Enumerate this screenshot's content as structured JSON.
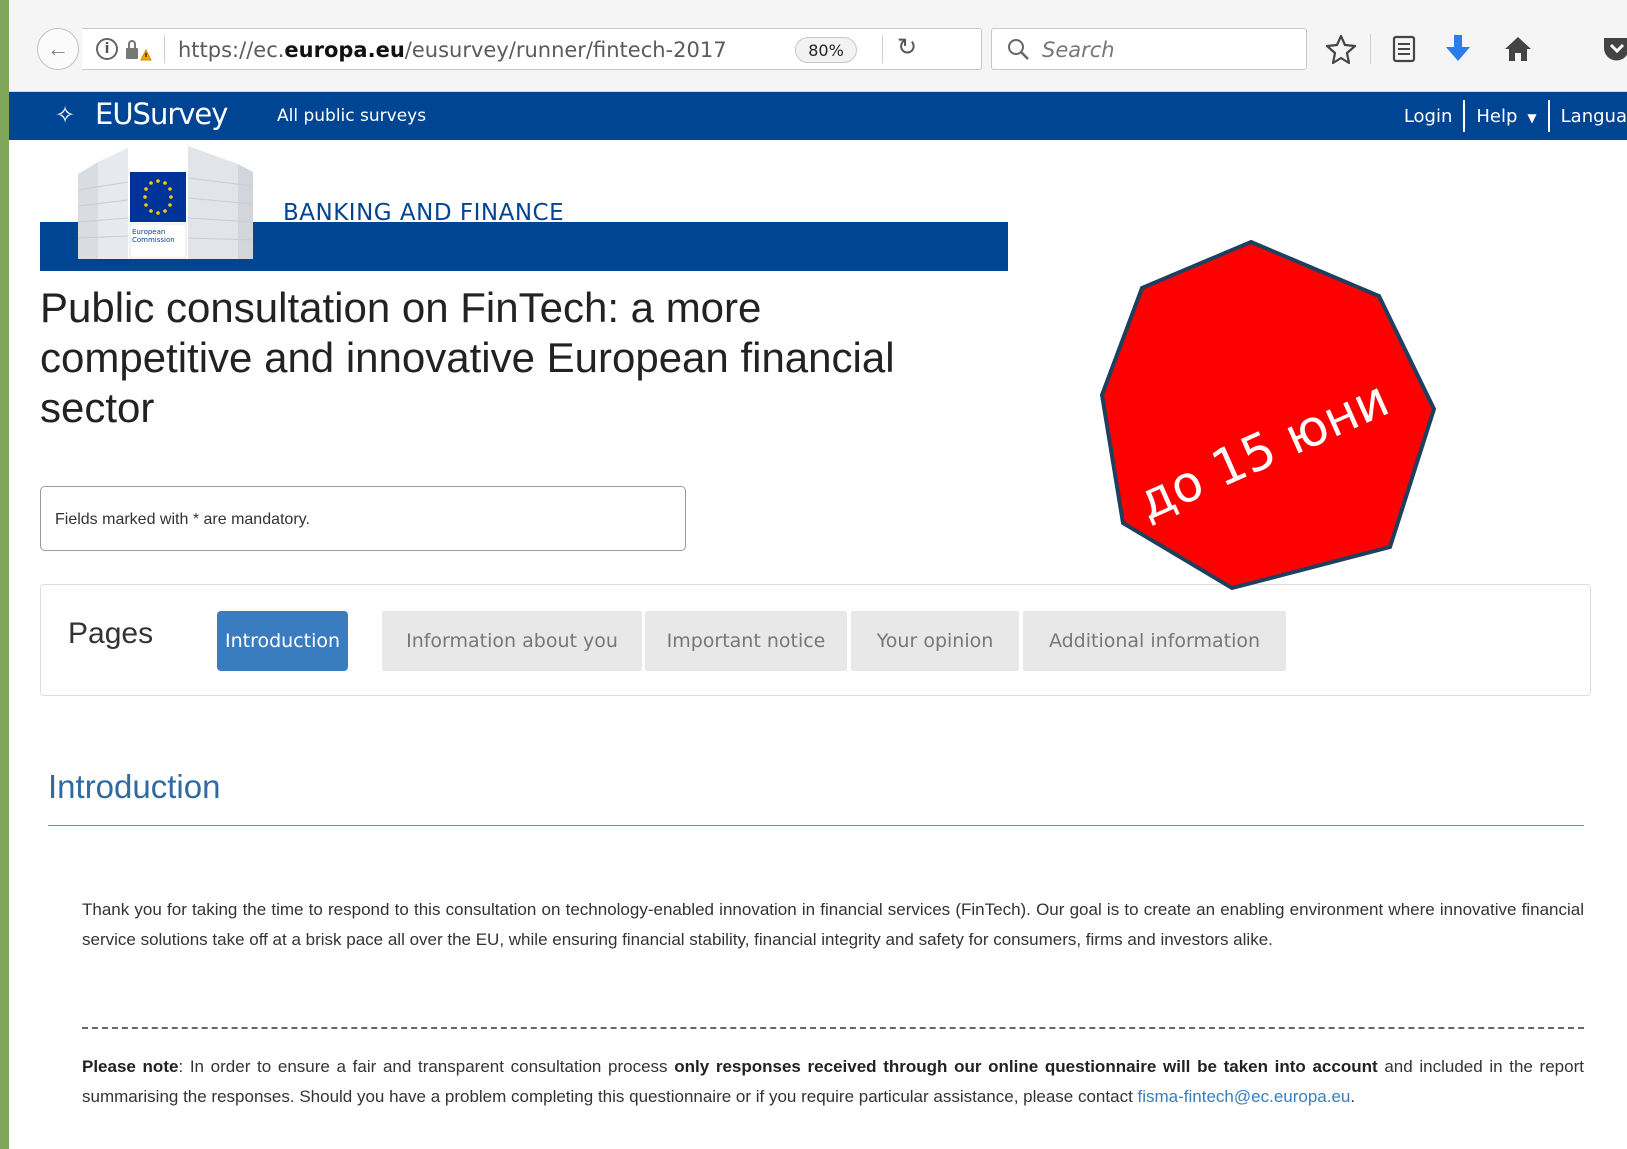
{
  "browser": {
    "url_prefix": "https://ec.",
    "url_domain": "europa.eu",
    "url_path": "/eusurvey/runner/fintech-2017",
    "zoom": "80%",
    "search_placeholder": "Search"
  },
  "eu_header": {
    "logo_text": "EUSurvey",
    "public_surveys": "All public surveys",
    "login": "Login",
    "help": "Help",
    "language": "Langua"
  },
  "banner": {
    "title": "BANKING AND FINANCE",
    "logo_caption_1": "European",
    "logo_caption_2": "Commission"
  },
  "survey": {
    "title": "Public consultation on FinTech: a more competitive and innovative European financial sector",
    "mandatory_note": "Fields marked with * are mandatory."
  },
  "pages": {
    "label": "Pages",
    "tabs": [
      {
        "label": "Introduction",
        "active": true
      },
      {
        "label": "Information about you",
        "active": false
      },
      {
        "label": "Important notice",
        "active": false
      },
      {
        "label": "Your opinion",
        "active": false
      },
      {
        "label": "Additional information",
        "active": false
      }
    ]
  },
  "introduction": {
    "heading": "Introduction",
    "paragraph1": "Thank you for taking the time to respond to this consultation on technology-enabled innovation in financial services (FinTech). Our goal is to create an enabling environment where innovative financial service solutions take off at a brisk pace all over the EU, while ensuring financial stability, financial integrity and safety for consumers, firms and investors alike.",
    "note_label": "Please note",
    "note_part1": ": In order to ensure a fair and transparent consultation process ",
    "note_bold": "only responses received through our online questionnaire will be taken into account",
    "note_part2": " and included in the report summarising the responses. Should you have a problem completing this questionnaire or if you require particular assistance, please contact ",
    "email": "fisma-fintech@ec.europa.eu",
    "note_end": "."
  },
  "stop_sign": {
    "text": "до 15 юни",
    "fill_color": "#ff0000",
    "border_color": "#1f3f5f"
  },
  "colors": {
    "eu_blue": "#004494",
    "active_tab": "#3a7cc0",
    "heading_blue": "#2f6aa1"
  }
}
